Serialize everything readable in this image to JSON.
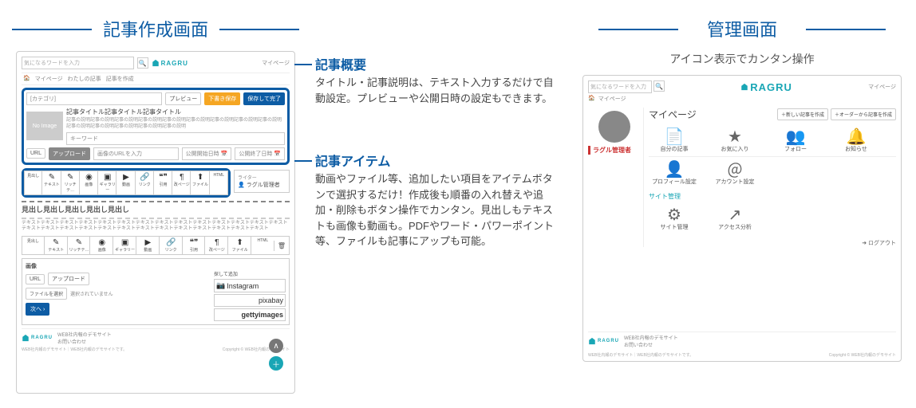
{
  "sections": {
    "editor_title": "記事作成画面",
    "admin_title": "管理画面",
    "admin_subtitle": "アイコン表示でカンタン操作"
  },
  "callouts": {
    "summary": {
      "title": "記事概要",
      "body": "タイトル・記事説明は、テキスト入力するだけで自動設定。プレビューや公開日時の設定もできます。"
    },
    "items": {
      "title": "記事アイテム",
      "body": "動画やファイル等、追加したい項目をアイテムボタンで選択するだけ！作成後も順番の入れ替えや追加・削除もボタン操作でカンタン。見出しもテキストも画像も動画も。PDFやワード・パワーポイント等、ファイルも記事にアップも可能。"
    }
  },
  "editor": {
    "search_ph": "気になるワードを入力",
    "brand": "RAGRU",
    "mypage": "マイページ",
    "breadcrumb": [
      "🏠",
      "マイページ",
      "わたしの記事",
      "記事を作成"
    ],
    "category_ph": "[カテゴリ]",
    "btn_preview": "プレビュー",
    "btn_draft": "下書き保存",
    "btn_publish": "保存して完了",
    "noimage": "No Image",
    "title_sample": "記事タイトル記事タイトル記事タイトル",
    "desc_sample": "記事の説明記事の説明記事の説明記事の説明記事の説明記事の説明記事の説明記事の説明記事の説明記事の説明記事の説明記事の説明記事の説明記事の説明",
    "keyword_ph": "キーワード",
    "tab_url": "URL",
    "tab_upload": "アップロード",
    "url_ph": "画像のURLを入力",
    "date1": "公開開始日時",
    "date2": "公開終了日時",
    "tools": [
      {
        "icon": "</>",
        "label": "見出し"
      },
      {
        "icon": "✎",
        "label": "テキスト"
      },
      {
        "icon": "✎",
        "label": "リッチテ…"
      },
      {
        "icon": "◉",
        "label": "画像"
      },
      {
        "icon": "▣",
        "label": "ギャラリー"
      },
      {
        "icon": "▶",
        "label": "動画"
      },
      {
        "icon": "🔗",
        "label": "リンク"
      },
      {
        "icon": "❝❞",
        "label": "引用"
      },
      {
        "icon": "¶",
        "label": "改ページ"
      },
      {
        "icon": "⬆",
        "label": "ファイル"
      },
      {
        "icon": "</>",
        "label": "HTML"
      }
    ],
    "writer_label": "ライター",
    "writer_name": "ラグル管理者",
    "heading_sample": "見出し見出し見出し見出し見出し",
    "para_sample": "テキストテキストテキストテキストテキストテキストテキストテキストテキストテキストテキストテキストテキストテキストテキストテキストテキストテキストテキストテキストテキストテキストテキストテキストテキストテキストテキスト",
    "imgsrc_title": "画像",
    "imgsrc_search": "探して追加",
    "file_label": "ファイルを選択",
    "file_none": "選択されていません",
    "next": "次へ ›",
    "svc1": "Instagram",
    "svc2": "pixabay",
    "svc3": "gettyimages",
    "footer_brand": "RAGRU",
    "footer_site": "WEB社内報のデモサイト",
    "footer_contact": "お問い合わせ",
    "footer_note": "WEB社内報のデモサイト｜WEB社内報のデモサイトです。",
    "footer_copy": "Copyright © WEB社内報のデモサイト"
  },
  "mypage": {
    "user": "ラグル管理者",
    "title": "マイページ",
    "btn_new": "＋新しい記事を作成",
    "btn_order": "＋オーダーから記事を作成",
    "grid1": [
      {
        "icon": "📄",
        "label": "自分の記事"
      },
      {
        "icon": "★",
        "label": "お気に入り"
      },
      {
        "icon": "👥",
        "label": "フォロー"
      },
      {
        "icon": "🔔",
        "label": "お知らせ"
      }
    ],
    "grid2": [
      {
        "icon": "👤",
        "label": "プロフィール設定"
      },
      {
        "icon": "＠",
        "label": "アカウント設定"
      }
    ],
    "site_label": "サイト管理",
    "grid3": [
      {
        "icon": "⚙",
        "label": "サイト管理"
      },
      {
        "icon": "↗",
        "label": "アクセス分析"
      }
    ],
    "logout": "➜ ログアウト"
  }
}
